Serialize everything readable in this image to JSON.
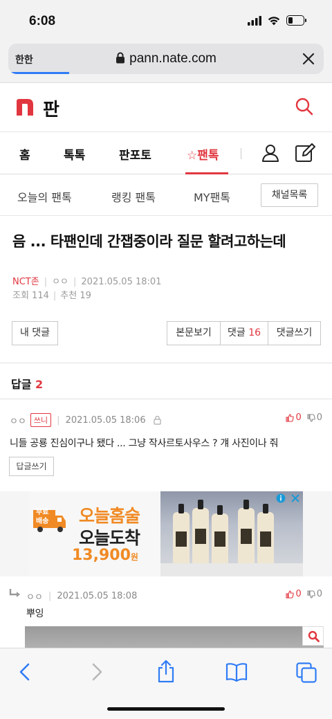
{
  "status": {
    "time": "6:08"
  },
  "browser": {
    "reader_label": "한한",
    "url": "pann.nate.com"
  },
  "site": {
    "logo_text": "판"
  },
  "main_nav": [
    "홈",
    "톡톡",
    "판포토",
    "☆팬톡"
  ],
  "sub_nav": {
    "items": [
      "오늘의 팬톡",
      "랭킹 팬톡",
      "MY팬톡"
    ],
    "channel_button": "채널목록"
  },
  "post": {
    "title": "음 ... 타팬인데 간잽중이라 질문 할려고하는데",
    "channel": "NCT존",
    "author": "ㅇㅇ",
    "datetime": "2021.05.05 18:01",
    "views": "조회 114",
    "recommend": "추천 19"
  },
  "buttons": {
    "my_comments": "내 댓글",
    "view_post": "본문보기",
    "comments_label": "댓글",
    "comments_count": "16",
    "write_comment": "댓글쓰기"
  },
  "replies": {
    "label": "답글",
    "count": "2",
    "items": [
      {
        "author": "ㅇㅇ",
        "badge": "쓰니",
        "datetime": "2021.05.05 18:06",
        "up": "0",
        "down": "0",
        "text": "니들 공룡 진심이구나 됐다 ... 그냥 작사르토사우스 ? 걔 사진이나 줘",
        "reply_button": "답글쓰기"
      },
      {
        "author": "ㅇㅇ",
        "datetime": "2021.05.05 18:08",
        "up": "0",
        "down": "0",
        "text": "뿌잉"
      }
    ]
  },
  "ad": {
    "badge_top": "무료",
    "badge_bottom": "배송",
    "line1": "오늘홈술",
    "line2": "오늘도착",
    "price": "13,900",
    "price_unit": "원"
  },
  "colors": {
    "accent": "#e1363f",
    "ios_blue": "#2f7cf6",
    "ad_orange": "#f08a24"
  }
}
